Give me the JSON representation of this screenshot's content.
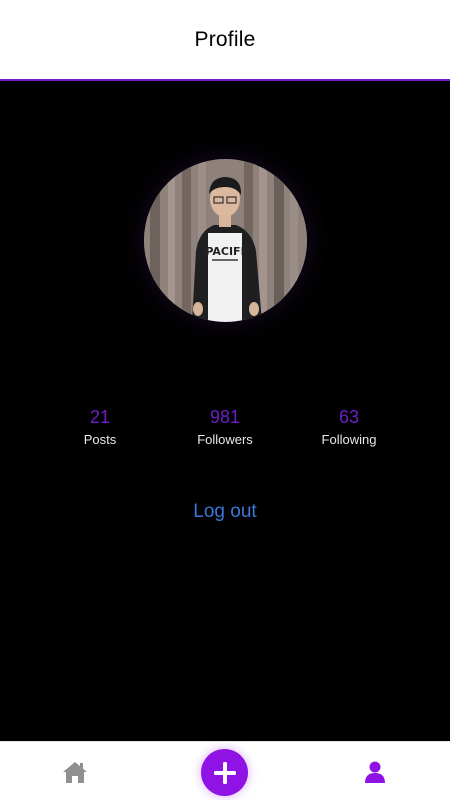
{
  "header": {
    "title": "Profile"
  },
  "stats": [
    {
      "value": "21",
      "label": "Posts"
    },
    {
      "value": "981",
      "label": "Followers"
    },
    {
      "value": "63",
      "label": "Following"
    }
  ],
  "logout_label": "Log out",
  "tabbar": {
    "items": [
      {
        "icon": "home-icon"
      },
      {
        "icon": "plus-icon"
      },
      {
        "icon": "user-icon"
      }
    ]
  },
  "colors": {
    "accent": "#9013e6",
    "stat_value": "#6d1ec7",
    "link": "#3a78d8",
    "tab_inactive": "#8f8f8f"
  }
}
